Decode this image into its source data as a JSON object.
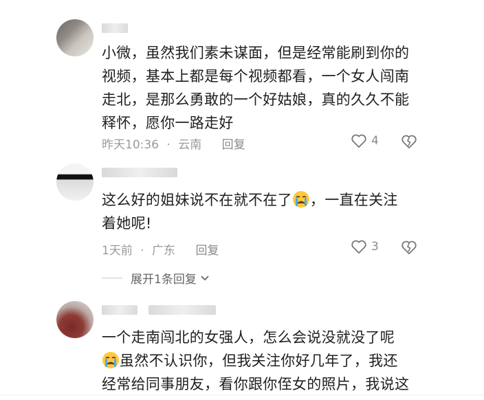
{
  "comments": [
    {
      "lines": [
        "小微，虽然我们素未谋面，但是经常能刷到你的",
        "视频，基本上都是每个视频都看，一个女人闯南",
        "走北，是那么勇敢的一个好姑娘，真的久久不能",
        "释怀，愿你一路走好"
      ],
      "time": "昨天10:36",
      "location": "云南",
      "reply": "回复",
      "likes": "4"
    },
    {
      "line1_before": "这么好的姐妹说不在就不在了",
      "line1_after": "，一直在关注",
      "line2": "着她呢!",
      "time": "1天前",
      "location": "广东",
      "reply": "回复",
      "likes": "3"
    },
    {
      "line1": "一个走南闯北的女强人，怎么会说没就没了呢",
      "line2_after_emoji": "虽然不认识你，但我关注你好几年了，我还",
      "line3": "经常给同事朋友，看你跟你侄女的照片，我说这"
    }
  ],
  "expand_replies": "展开1条回复",
  "icons": {
    "like": "heart-outline-icon",
    "dislike": "broken-heart-icon",
    "emoji": "crying-face-emoji",
    "expand": "chevron-down-icon"
  }
}
